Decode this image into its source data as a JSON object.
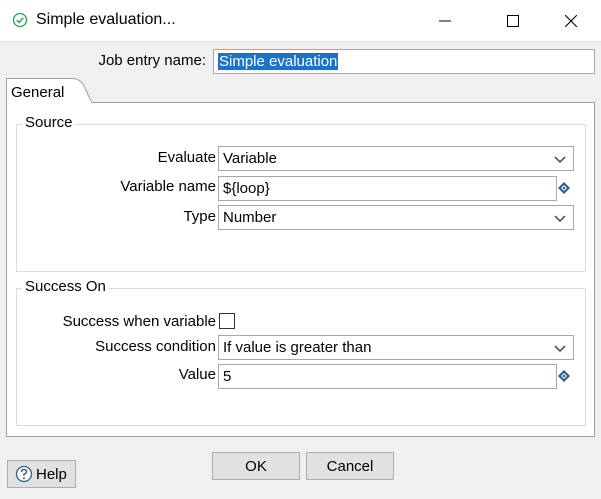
{
  "window": {
    "title": "Simple evaluation...",
    "title_icon": "check-circle-icon",
    "controls": [
      "minimize-icon",
      "maximize-icon",
      "close-icon"
    ]
  },
  "job_entry": {
    "label": "Job entry name:",
    "value": "Simple evaluation"
  },
  "tabs": [
    {
      "label": "General",
      "selected": true
    }
  ],
  "source": {
    "title": "Source",
    "evaluate_label": "Evaluate",
    "evaluate_value": "Variable",
    "variable_name_label": "Variable name",
    "variable_name_value": "${loop}",
    "type_label": "Type",
    "type_value": "Number"
  },
  "success_on": {
    "title": "Success On",
    "success_when_variable_label": "Success when variable",
    "success_when_variable_checked": false,
    "success_condition_label": "Success condition",
    "success_condition_value": "If value is greater than",
    "value_label": "Value",
    "value_value": "5"
  },
  "buttons": {
    "help": "Help",
    "ok": "OK",
    "cancel": "Cancel"
  },
  "colors": {
    "selection": "#1a73c9",
    "check_icon": "#2e9d4a",
    "variable_icon": "#2f5d8a"
  }
}
